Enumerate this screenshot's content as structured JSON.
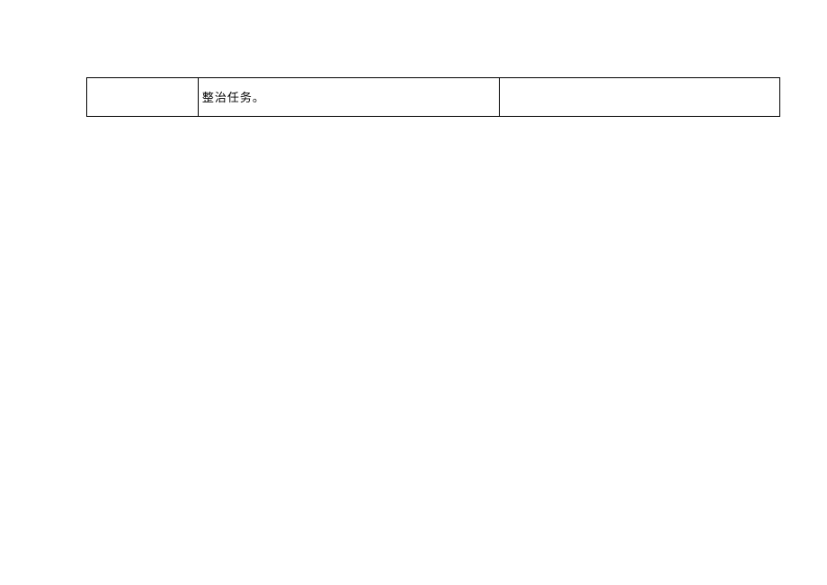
{
  "table": {
    "rows": [
      {
        "col1": "",
        "col2": "整治任务。",
        "col3": ""
      }
    ]
  }
}
